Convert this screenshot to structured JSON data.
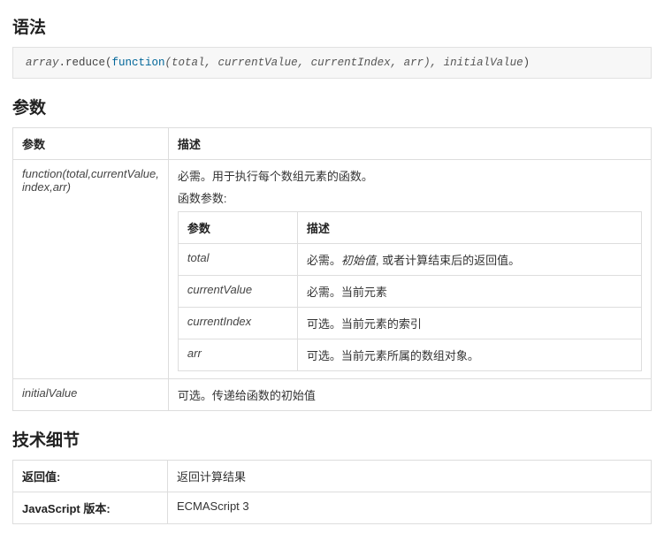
{
  "syntax": {
    "heading": "语法",
    "code_arr": "array",
    "code_fn": ".reduce(",
    "code_kw": "function",
    "code_sig": "(total, currentValue, currentIndex, arr), initialValue",
    "code_close": ")"
  },
  "params": {
    "heading": "参数",
    "th_param": "参数",
    "th_desc": "描述",
    "row1_param": "function(total,currentValue, index,arr)",
    "row1_desc_l1": "必需。用于执行每个数组元素的函数。",
    "row1_desc_l2": "函数参数:",
    "inner_th_param": "参数",
    "inner_th_desc": "描述",
    "inner": [
      {
        "param": "total",
        "desc_prefix": "必需。",
        "desc_em": "初始值",
        "desc_suffix": ", 或者计算结束后的返回值。"
      },
      {
        "param": "currentValue",
        "desc_prefix": "必需。当前元素",
        "desc_em": "",
        "desc_suffix": ""
      },
      {
        "param": "currentIndex",
        "desc_prefix": "可选。当前元素的索引",
        "desc_em": "",
        "desc_suffix": ""
      },
      {
        "param": "arr",
        "desc_prefix": "可选。当前元素所属的数组对象。",
        "desc_em": "",
        "desc_suffix": ""
      }
    ],
    "row2_param": "initialValue",
    "row2_desc": "可选。传递给函数的初始值"
  },
  "tech": {
    "heading": "技术细节",
    "row1_label": "返回值:",
    "row1_value": "返回计算结果",
    "row2_label": "JavaScript 版本:",
    "row2_value": "ECMAScript 3"
  }
}
